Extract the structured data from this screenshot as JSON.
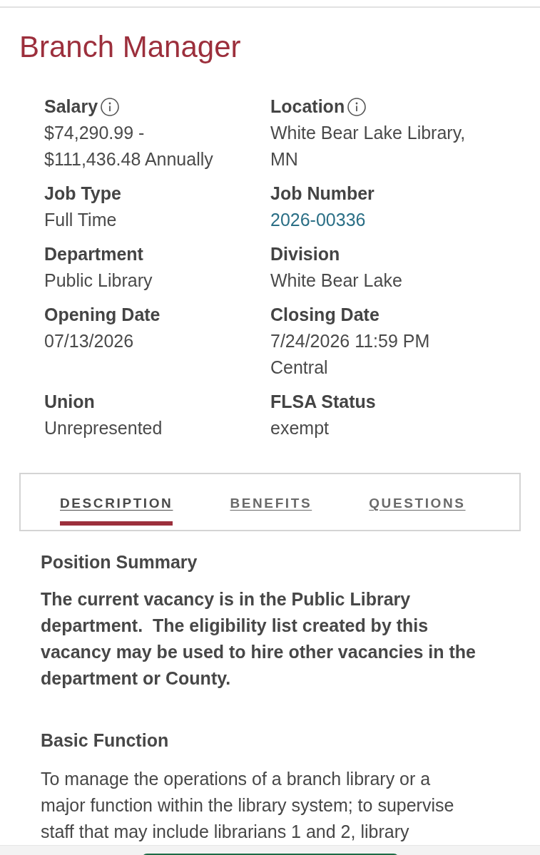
{
  "title": "Branch Manager",
  "details": [
    {
      "label": "Salary",
      "value": "$74,290.99 - $111,436.48 Annually",
      "info": true,
      "kind": "text"
    },
    {
      "label": "Location",
      "value": "White Bear Lake Library, MN",
      "info": true,
      "kind": "text"
    },
    {
      "label": "Job Type",
      "value": "Full Time",
      "info": false,
      "kind": "text"
    },
    {
      "label": "Job Number",
      "value": "2026-00336",
      "info": false,
      "kind": "link"
    },
    {
      "label": "Department",
      "value": "Public Library",
      "info": false,
      "kind": "text"
    },
    {
      "label": "Division",
      "value": "White Bear Lake",
      "info": false,
      "kind": "text"
    },
    {
      "label": "Opening Date",
      "value": "07/13/2026",
      "info": false,
      "kind": "text"
    },
    {
      "label": "Closing Date",
      "value": "7/24/2026 11:59 PM Central",
      "info": false,
      "kind": "text"
    },
    {
      "label": "Union",
      "value": "Unrepresented",
      "info": false,
      "kind": "text"
    },
    {
      "label": "FLSA Status",
      "value": "exempt",
      "info": false,
      "kind": "text"
    }
  ],
  "tabs": [
    {
      "label": "DESCRIPTION",
      "selected": true
    },
    {
      "label": "BENEFITS",
      "selected": false
    },
    {
      "label": "QUESTIONS",
      "selected": false
    }
  ],
  "sections": [
    {
      "heading": "Position Summary",
      "text": "The current vacancy is in the Public Library department.  The eligibility list created by this vacancy may be used to hire other vacancies in the department or County.",
      "bold": true
    },
    {
      "heading": "Basic Function",
      "text": "To manage the operations of a branch library or a major function within the library system; to supervise staff that may include librarians 1 and 2, library",
      "bold": false
    }
  ]
}
